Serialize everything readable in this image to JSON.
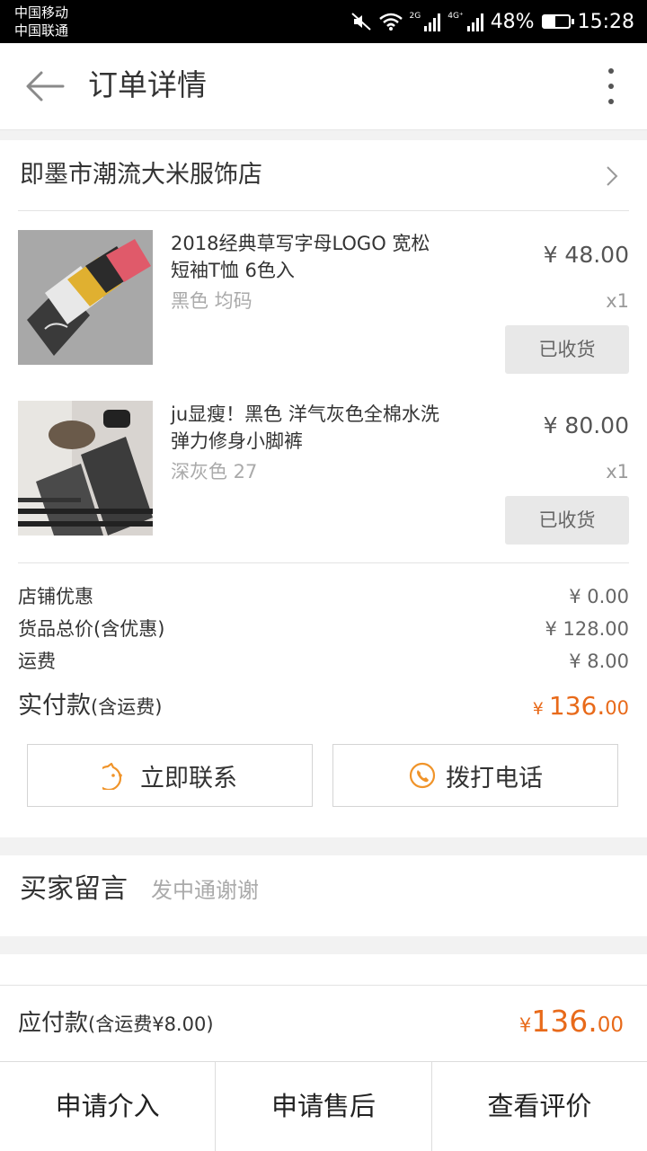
{
  "status_bar": {
    "carrier_1": "中国移动",
    "carrier_2": "中国联通",
    "sig1_tag": "2G",
    "sig2_tag": "4G⁺",
    "battery": "48%",
    "time": "15:28"
  },
  "navbar": {
    "title": "订单详情"
  },
  "shop": {
    "name": "即墨市潮流大米服饰店"
  },
  "items": [
    {
      "title": "2018经典草写字母LOGO 宽松短袖T恤 6色入",
      "spec": "黑色 均码",
      "price": "¥ 48.00",
      "qty": "x1",
      "status": "已收货"
    },
    {
      "title": "ju显瘦！黑色 洋气灰色全棉水洗弹力修身小脚裤",
      "spec": "深灰色 27",
      "price": "¥ 80.00",
      "qty": "x1",
      "status": "已收货"
    }
  ],
  "summary": {
    "shop_discount_label": "店铺优惠",
    "shop_discount_value": "¥ 0.00",
    "goods_total_label": "货品总价(含优惠)",
    "goods_total_value": "¥ 128.00",
    "shipping_label": "运费",
    "shipping_value": "¥ 8.00",
    "paid_label": "实付款",
    "paid_suffix": "(含运费)",
    "paid_yen": "¥ ",
    "paid_int": "136.",
    "paid_cents": "00"
  },
  "contact": {
    "chat_label": "立即联系",
    "call_label": "拨打电话"
  },
  "message": {
    "label": "买家留言",
    "text": "发中通谢谢"
  },
  "payable": {
    "label": "应付款",
    "suffix": "(含运费¥8.00)",
    "yen": "¥",
    "int": "136.",
    "cents": "00"
  },
  "actions": {
    "apply_intervention": "申请介入",
    "apply_after_sale": "申请售后",
    "view_review": "查看评价"
  },
  "colors": {
    "accent": "#e86a1a",
    "background": "#f2f2f2"
  }
}
